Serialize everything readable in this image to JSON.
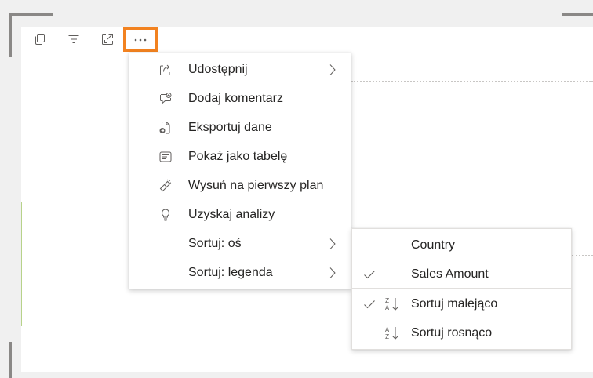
{
  "toolbar": {
    "icons": [
      "copy-icon",
      "filter-icon",
      "focus-mode-icon",
      "more-options-icon"
    ]
  },
  "menu": {
    "items": [
      {
        "label": "Udostępnij",
        "icon": "share-icon",
        "has_submenu": true
      },
      {
        "label": "Dodaj komentarz",
        "icon": "comment-icon",
        "has_submenu": false
      },
      {
        "label": "Eksportuj dane",
        "icon": "export-icon",
        "has_submenu": false
      },
      {
        "label": "Pokaż jako tabelę",
        "icon": "table-icon",
        "has_submenu": false
      },
      {
        "label": "Wysuń na pierwszy plan",
        "icon": "spotlight-icon",
        "has_submenu": false
      },
      {
        "label": "Uzyskaj analizy",
        "icon": "lightbulb-icon",
        "has_submenu": false
      },
      {
        "label": "Sortuj: oś",
        "icon": "",
        "has_submenu": true
      },
      {
        "label": "Sortuj: legenda",
        "icon": "",
        "has_submenu": true
      }
    ]
  },
  "submenu": {
    "items": [
      {
        "label": "Country",
        "checked": false,
        "icon": ""
      },
      {
        "label": "Sales Amount",
        "checked": true,
        "icon": ""
      },
      {
        "label": "Sortuj malejąco",
        "checked": true,
        "icon": "sort-descending-icon"
      },
      {
        "label": "Sortuj rosnąco",
        "checked": false,
        "icon": "sort-ascending-icon"
      }
    ]
  },
  "colors": {
    "highlight": "#f28220",
    "icon": "#605e5c",
    "text": "#252423",
    "background": "#f0f0f0"
  }
}
